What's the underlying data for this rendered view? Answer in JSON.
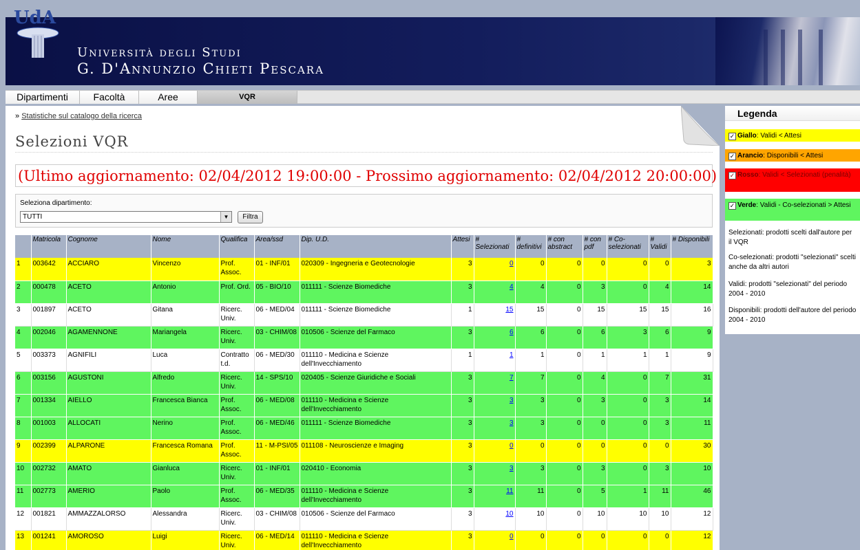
{
  "header": {
    "university_line1": "Università degli Studi",
    "university_line2": "G. D'Annunzio Chieti Pescara",
    "logo_text": "UdA"
  },
  "nav": {
    "tabs": [
      "Dipartimenti",
      "Facoltà",
      "Aree",
      "VQR"
    ],
    "active": "VQR"
  },
  "breadcrumb": {
    "prefix": "»",
    "link": "Statistiche sul catalogo della ricerca"
  },
  "page_title": "Selezioni VQR",
  "update_banner": "(Ultimo aggiornamento: 02/04/2012 19:00:00 - Prossimo aggiornamento: 02/04/2012 20:00:00)",
  "filter": {
    "label": "Seleziona dipartimento:",
    "selected": "TUTTI",
    "button": "Filtra"
  },
  "table": {
    "headers": [
      "",
      "Matricola",
      "Cognome",
      "Nome",
      "Qualifica",
      "Area/ssd",
      "Dip. U.D.",
      "Attesi",
      "# Selezionati",
      "# definitivi",
      "# con abstract",
      "# con pdf",
      "# Co-selezionati",
      "# Validi",
      "# Disponibili"
    ],
    "rows": [
      {
        "n": "1",
        "matricola": "003642",
        "cognome": "ACCIARO",
        "nome": "Vincenzo",
        "qualifica": "Prof. Assoc.",
        "area": "01 - INF/01",
        "dip": "020309 - Ingegneria e Geotecnologie",
        "attesi": "3",
        "selezionati": "0",
        "definitivi": "0",
        "abstract": "0",
        "pdf": "0",
        "coselezionati": "0",
        "validi": "0",
        "disponibili": "3",
        "color": "giallo"
      },
      {
        "n": "2",
        "matricola": "000478",
        "cognome": "ACETO",
        "nome": "Antonio",
        "qualifica": "Prof. Ord.",
        "area": "05 - BIO/10",
        "dip": "011111 - Scienze Biomediche",
        "attesi": "3",
        "selezionati": "4",
        "definitivi": "4",
        "abstract": "0",
        "pdf": "3",
        "coselezionati": "0",
        "validi": "4",
        "disponibili": "14",
        "color": "verde"
      },
      {
        "n": "3",
        "matricola": "001897",
        "cognome": "ACETO",
        "nome": "Gitana",
        "qualifica": "Ricerc. Univ.",
        "area": "06 - MED/04",
        "dip": "011111 - Scienze Biomediche",
        "attesi": "1",
        "selezionati": "15",
        "definitivi": "15",
        "abstract": "0",
        "pdf": "15",
        "coselezionati": "15",
        "validi": "15",
        "disponibili": "16",
        "color": "bianco"
      },
      {
        "n": "4",
        "matricola": "002046",
        "cognome": "AGAMENNONE",
        "nome": "Mariangela",
        "qualifica": "Ricerc. Univ.",
        "area": "03 - CHIM/08",
        "dip": "010506 - Scienze del Farmaco",
        "attesi": "3",
        "selezionati": "6",
        "definitivi": "6",
        "abstract": "0",
        "pdf": "6",
        "coselezionati": "3",
        "validi": "6",
        "disponibili": "9",
        "color": "verde"
      },
      {
        "n": "5",
        "matricola": "003373",
        "cognome": "AGNIFILI",
        "nome": "Luca",
        "qualifica": "Contratto t.d.",
        "area": "06 - MED/30",
        "dip": "011110 - Medicina e Scienze dell'Invecchiamento",
        "attesi": "1",
        "selezionati": "1",
        "definitivi": "1",
        "abstract": "0",
        "pdf": "1",
        "coselezionati": "1",
        "validi": "1",
        "disponibili": "9",
        "color": "bianco"
      },
      {
        "n": "6",
        "matricola": "003156",
        "cognome": "AGUSTONI",
        "nome": "Alfredo",
        "qualifica": "Ricerc. Univ.",
        "area": "14 - SPS/10",
        "dip": "020405 - Scienze Giuridiche e Sociali",
        "attesi": "3",
        "selezionati": "7",
        "definitivi": "7",
        "abstract": "0",
        "pdf": "4",
        "coselezionati": "0",
        "validi": "7",
        "disponibili": "31",
        "color": "verde"
      },
      {
        "n": "7",
        "matricola": "001334",
        "cognome": "AIELLO",
        "nome": "Francesca Bianca",
        "qualifica": "Prof. Assoc.",
        "area": "06 - MED/08",
        "dip": "011110 - Medicina e Scienze dell'Invecchiamento",
        "attesi": "3",
        "selezionati": "3",
        "definitivi": "3",
        "abstract": "0",
        "pdf": "3",
        "coselezionati": "0",
        "validi": "3",
        "disponibili": "14",
        "color": "verde"
      },
      {
        "n": "8",
        "matricola": "001003",
        "cognome": "ALLOCATI",
        "nome": "Nerino",
        "qualifica": "Prof. Assoc.",
        "area": "06 - MED/46",
        "dip": "011111 - Scienze Biomediche",
        "attesi": "3",
        "selezionati": "3",
        "definitivi": "3",
        "abstract": "0",
        "pdf": "0",
        "coselezionati": "0",
        "validi": "3",
        "disponibili": "11",
        "color": "verde"
      },
      {
        "n": "9",
        "matricola": "002399",
        "cognome": "ALPARONE",
        "nome": "Francesca Romana",
        "qualifica": "Prof. Assoc.",
        "area": "11 - M-PSI/05",
        "dip": "011108 - Neuroscienze e Imaging",
        "attesi": "3",
        "selezionati": "0",
        "definitivi": "0",
        "abstract": "0",
        "pdf": "0",
        "coselezionati": "0",
        "validi": "0",
        "disponibili": "30",
        "color": "giallo"
      },
      {
        "n": "10",
        "matricola": "002732",
        "cognome": "AMATO",
        "nome": "Gianluca",
        "qualifica": "Ricerc. Univ.",
        "area": "01 - INF/01",
        "dip": "020410 - Economia",
        "attesi": "3",
        "selezionati": "3",
        "definitivi": "3",
        "abstract": "0",
        "pdf": "3",
        "coselezionati": "0",
        "validi": "3",
        "disponibili": "10",
        "color": "verde"
      },
      {
        "n": "11",
        "matricola": "002773",
        "cognome": "AMERIO",
        "nome": "Paolo",
        "qualifica": "Prof. Assoc.",
        "area": "06 - MED/35",
        "dip": "011110 - Medicina e Scienze dell'Invecchiamento",
        "attesi": "3",
        "selezionati": "11",
        "definitivi": "11",
        "abstract": "0",
        "pdf": "5",
        "coselezionati": "1",
        "validi": "11",
        "disponibili": "46",
        "color": "verde"
      },
      {
        "n": "12",
        "matricola": "001821",
        "cognome": "AMMAZZALORSO",
        "nome": "Alessandra",
        "qualifica": "Ricerc. Univ.",
        "area": "03 - CHIM/08",
        "dip": "010506 - Scienze del Farmaco",
        "attesi": "3",
        "selezionati": "10",
        "definitivi": "10",
        "abstract": "0",
        "pdf": "10",
        "coselezionati": "10",
        "validi": "10",
        "disponibili": "12",
        "color": "bianco"
      },
      {
        "n": "13",
        "matricola": "001241",
        "cognome": "AMOROSO",
        "nome": "Luigi",
        "qualifica": "Ricerc. Univ.",
        "area": "06 - MED/14",
        "dip": "011110 - Medicina e Scienze dell'Invecchiamento",
        "attesi": "3",
        "selezionati": "0",
        "definitivi": "0",
        "abstract": "0",
        "pdf": "0",
        "coselezionati": "0",
        "validi": "0",
        "disponibili": "12",
        "color": "giallo"
      }
    ]
  },
  "legend": {
    "title": "Legenda",
    "items": [
      {
        "bold": "Giallo",
        "text": ": Validi < Attesi",
        "bg": "#ffff00",
        "color": "#000000"
      },
      {
        "bold": "Arancio",
        "text": ": Disponibili < Attesi",
        "bg": "#ffa500",
        "color": "#000000"
      },
      {
        "bold": "Rosso",
        "text": ": Validi < Selezionati (penalità)",
        "bg": "#ff0000",
        "color": "#7a0000"
      },
      {
        "bold": "Verde",
        "text": ": Validi - Co-selezionati > Attesi",
        "bg": "#5ff55f",
        "color": "#000000"
      }
    ],
    "notes": [
      "Selezionati: prodotti scelti dall'autore per il VQR",
      "Co-selezionati: prodotti \"selezionati\" scelti anche da altri autori",
      "Validi: prodotti \"selezionati\" del periodo 2004 - 2010",
      "Disponibili: prodotti dell'autore del periodo 2004 - 2010"
    ]
  },
  "colors": {
    "giallo": "#ffff00",
    "verde": "#5ff55f",
    "header_bg": "#a7b2c6",
    "banner_bg": "#0c1450",
    "update_text": "#e00000"
  }
}
